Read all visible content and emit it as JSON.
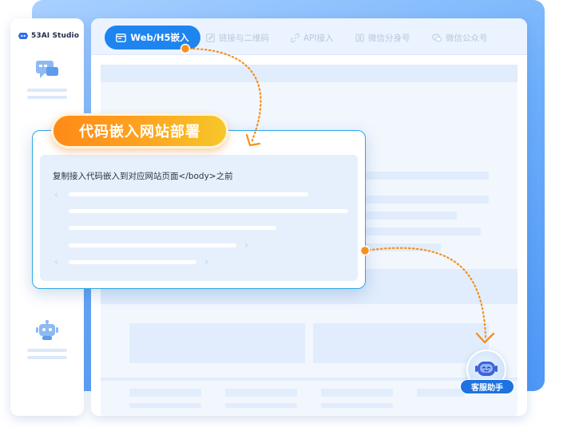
{
  "brand": {
    "name": "53AI Studio"
  },
  "tabs": [
    {
      "label": "Web/H5嵌入",
      "active": true,
      "icon": "browser-window-icon"
    },
    {
      "label": "链接与二维码",
      "active": false,
      "icon": "edit-icon"
    },
    {
      "label": "API接入",
      "active": false,
      "icon": "link-icon"
    },
    {
      "label": "微信分身号",
      "active": false,
      "icon": "wechat-clone-icon"
    },
    {
      "label": "微信公众号",
      "active": false,
      "icon": "wechat-official-icon"
    }
  ],
  "popup": {
    "badge": "代码嵌入网站部署",
    "description": "复制接入代码嵌入到对应网站页面</body>之前"
  },
  "assistant": {
    "label": "客服助手",
    "icon": "robot-assistant-icon"
  },
  "colors": {
    "accent": "#1e84f0",
    "badge_start": "#ff8a18",
    "badge_end": "#f6c72a",
    "arrow": "#f5901f",
    "back_card": "#6fb0fb"
  }
}
